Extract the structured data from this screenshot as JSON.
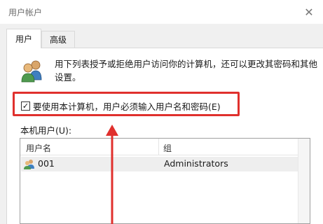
{
  "window": {
    "title": "用户帐户",
    "close_symbol": "✕"
  },
  "tabs": [
    {
      "label": "用户",
      "active": true
    },
    {
      "label": "高级",
      "active": false
    }
  ],
  "description": "用下列表授予或拒绝用户访问你的计算机，还可以更改其密码和其他设置。",
  "require_login": {
    "label": "要使用本计算机，用户必须输入用户名和密码(E)",
    "checked": true,
    "check_symbol": "✓"
  },
  "users_section": {
    "label": "本机用户(U):",
    "columns": [
      "用户名",
      "组"
    ],
    "rows": [
      {
        "username": "001",
        "group": "Administrators"
      }
    ]
  },
  "colors": {
    "highlight": "#e0302d",
    "arrow": "#e0302d",
    "selected_row": "#eeeeee"
  },
  "icons": {
    "header": "users-icon",
    "row": "user-account-icon"
  }
}
